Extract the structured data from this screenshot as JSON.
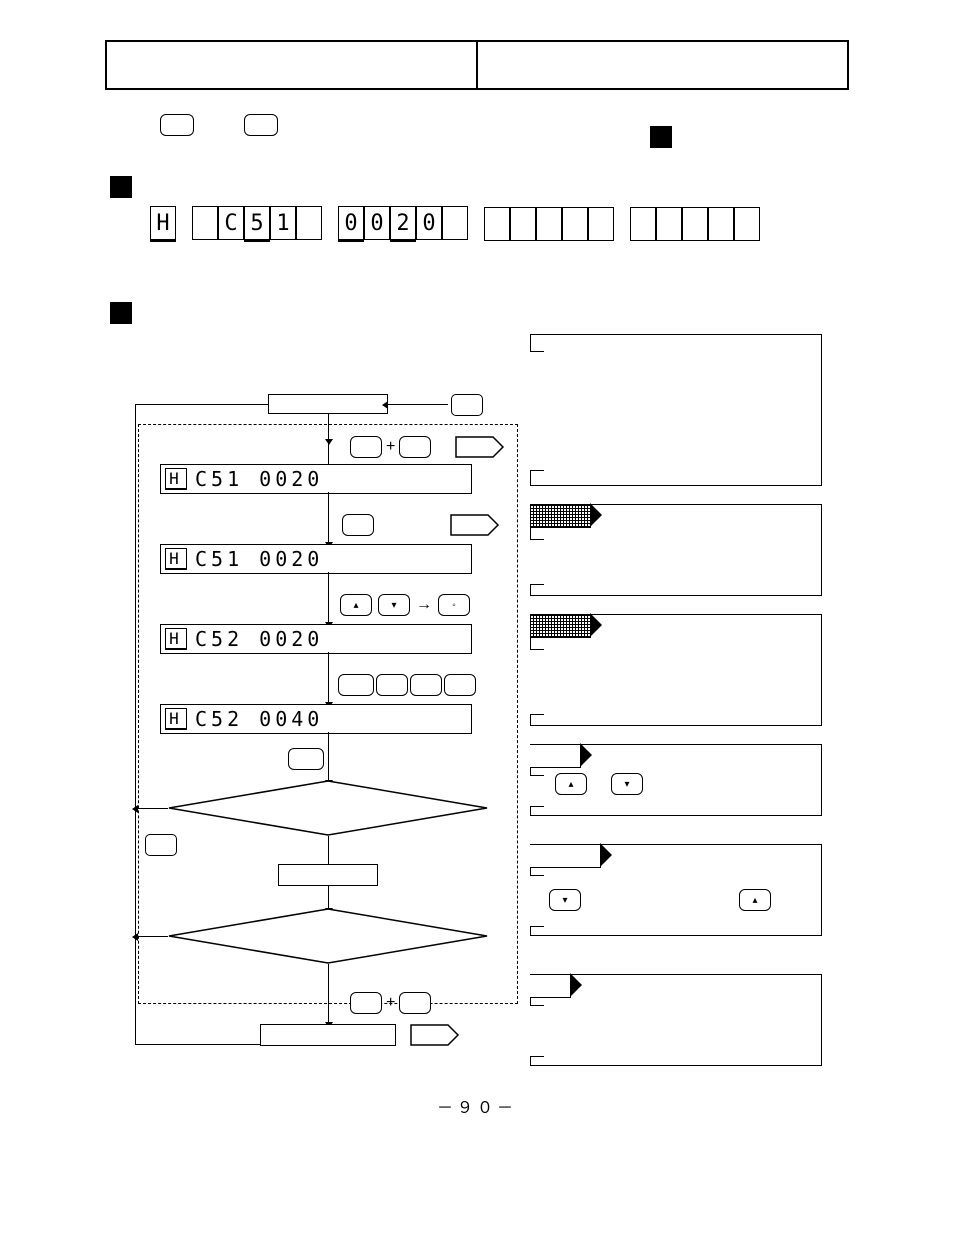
{
  "page_number": "－９０－",
  "seg_display_sample": [
    "H",
    "",
    "C",
    "5",
    "1",
    "",
    "0",
    "0",
    "2",
    "0",
    "",
    "",
    "",
    "",
    "",
    "",
    "",
    "",
    "",
    "",
    ""
  ],
  "flow": {
    "d1": "C51 0020",
    "d2": "C51 0020",
    "d3": "C52 0020",
    "d4": "C52 0040",
    "plus": "+",
    "arrow": "→",
    "tri_up": "▴",
    "tri_down": "▾",
    "dot": "◦"
  },
  "side": {
    "tri_up": "▴",
    "tri_down": "▾"
  }
}
